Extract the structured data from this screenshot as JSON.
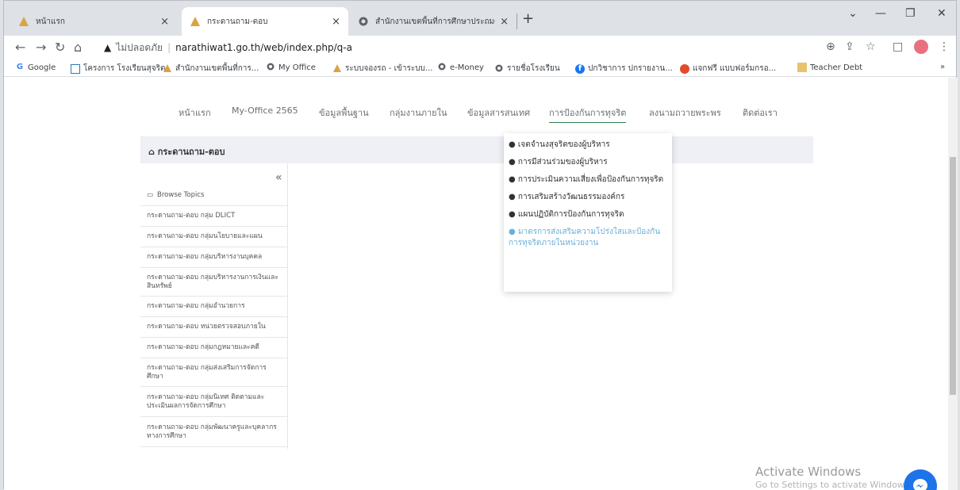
{
  "tabs": [
    {
      "title": "หน้าแรก",
      "close": "×"
    },
    {
      "title": "กระดานถาม-ตอบ",
      "close": "×"
    },
    {
      "title": "สำนักงานเขตพื้นที่การศึกษาประถมศึก",
      "close": "×"
    }
  ],
  "new_tab": "+",
  "window_controls": {
    "dropdown": "⌄",
    "minimize": "—",
    "restore": "❐",
    "close": "✕"
  },
  "address": {
    "insecure_label": "ไม่ปลอดภัย",
    "url": "narathiwat1.go.th/web/index.php/q-a"
  },
  "bookmarks": [
    {
      "label": "Google",
      "icon": "google-icon"
    },
    {
      "label": "โครงการ โรงเรียนสุจริต",
      "icon": "table-icon"
    },
    {
      "label": "สำนักงานเขตพื้นที่การ...",
      "icon": "logo-icon"
    },
    {
      "label": "My Office",
      "icon": "globe-icon"
    },
    {
      "label": "ระบบจองรถ - เข้าระบบ...",
      "icon": "logo-icon"
    },
    {
      "label": "e-Money",
      "icon": "globe-icon"
    },
    {
      "label": "รายชื่อโรงเรียน",
      "icon": "globe-icon"
    },
    {
      "label": "ปกวิชาการ ปกรายงาน...",
      "icon": "facebook-icon"
    },
    {
      "label": "แจกฟรี แบบฟอร์มกรอ...",
      "icon": "logo-icon"
    },
    {
      "label": "Teacher Debt",
      "icon": "folder-icon"
    }
  ],
  "bookmarks_more": "»",
  "menu": [
    {
      "label": "หน้าแรก"
    },
    {
      "label": "My-Office 2565"
    },
    {
      "label": "ข้อมูลพื้นฐาน"
    },
    {
      "label": "กลุ่มงานภายใน"
    },
    {
      "label": "ข้อมูลสารสนเทศ"
    },
    {
      "label": "การป้องกันการทุจริต"
    },
    {
      "label": "ลงนามถวายพระพร"
    },
    {
      "label": "ติดต่อเรา"
    }
  ],
  "breadcrumb": {
    "icon": "home-icon",
    "label": "กระดานถาม-ตอบ"
  },
  "sidebar": {
    "collapse_glyph": "«",
    "browse_label": "Browse Topics",
    "items": [
      {
        "label": "กระดานถาม-ตอบ กลุ่ม DLICT"
      },
      {
        "label": "กระดานถาม-ตอบ กลุ่มนโยบายและแผน"
      },
      {
        "label": "กระดานถาม-ตอบ กลุ่มบริหารงานบุคคล"
      },
      {
        "label": "กระดานถาม-ตอบ กลุ่มบริหารงานการเงินและสินทรัพย์"
      },
      {
        "label": "กระดานถาม-ตอบ กลุ่มอำนวยการ"
      },
      {
        "label": "กระดานถาม-ตอบ หน่วยตรวจสอบภายใน"
      },
      {
        "label": "กระดานถาม-ตอบ กลุ่มกฎหมายและคดี"
      },
      {
        "label": "กระดานถาม-ตอบ กลุ่มส่งเสริมการจัดการศึกษา"
      },
      {
        "label": "กระดานถาม-ตอบ กลุ่มนิเทศ ติดตามและประเมินผลการจัดการศึกษา"
      },
      {
        "label": "กระดานถาม-ตอบ กลุ่มพัฒนาครูและบุคลากรทางการศึกษา"
      }
    ]
  },
  "dropdown": [
    {
      "label": "เจตจำนงสุจริตของผู้บริหาร"
    },
    {
      "label": "การมีส่วนร่วมของผู้บริหาร"
    },
    {
      "label": "การประเมินความเสี่ยงเพื่อป้องกันการทุจริต"
    },
    {
      "label": "การเสริมสร้างวัฒนธรรมองค์กร"
    },
    {
      "label": "แผนปฏิบัติการป้องกันการทุจริต"
    },
    {
      "label": "มาตรการส่งเสริมความโปร่งใสและป้องกันการทุจริตภายในหน่วยงาน"
    }
  ],
  "dot": "●",
  "watermark": {
    "title": "Activate Windows",
    "subtitle": "Go to Settings to activate Windows."
  }
}
